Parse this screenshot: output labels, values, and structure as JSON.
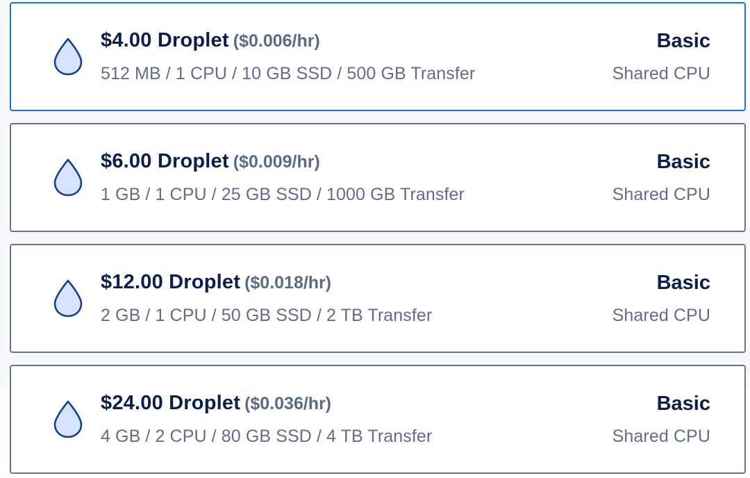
{
  "plans": [
    {
      "price": "$4.00 Droplet",
      "hourly": "($0.006/hr)",
      "specs": "512 MB / 1 CPU / 10 GB SSD / 500 GB Transfer",
      "tier": "Basic",
      "cpu_type": "Shared CPU",
      "selected": true
    },
    {
      "price": "$6.00 Droplet",
      "hourly": "($0.009/hr)",
      "specs": "1 GB / 1 CPU / 25 GB SSD / 1000 GB Transfer",
      "tier": "Basic",
      "cpu_type": "Shared CPU",
      "selected": false
    },
    {
      "price": "$12.00 Droplet",
      "hourly": "($0.018/hr)",
      "specs": "2 GB / 1 CPU / 50 GB SSD / 2 TB Transfer",
      "tier": "Basic",
      "cpu_type": "Shared CPU",
      "selected": false
    },
    {
      "price": "$24.00 Droplet",
      "hourly": "($0.036/hr)",
      "specs": "4 GB / 2 CPU / 80 GB SSD / 4 TB Transfer",
      "tier": "Basic",
      "cpu_type": "Shared CPU",
      "selected": false
    }
  ],
  "icon": "droplet-icon",
  "colors": {
    "selected_border": "#1b6fd6",
    "default_border": "#6b7283",
    "title": "#0b1f4a",
    "muted_text": "#5f6e88",
    "droplet_fill": "#d6e4fb",
    "droplet_stroke": "#123f8f"
  }
}
